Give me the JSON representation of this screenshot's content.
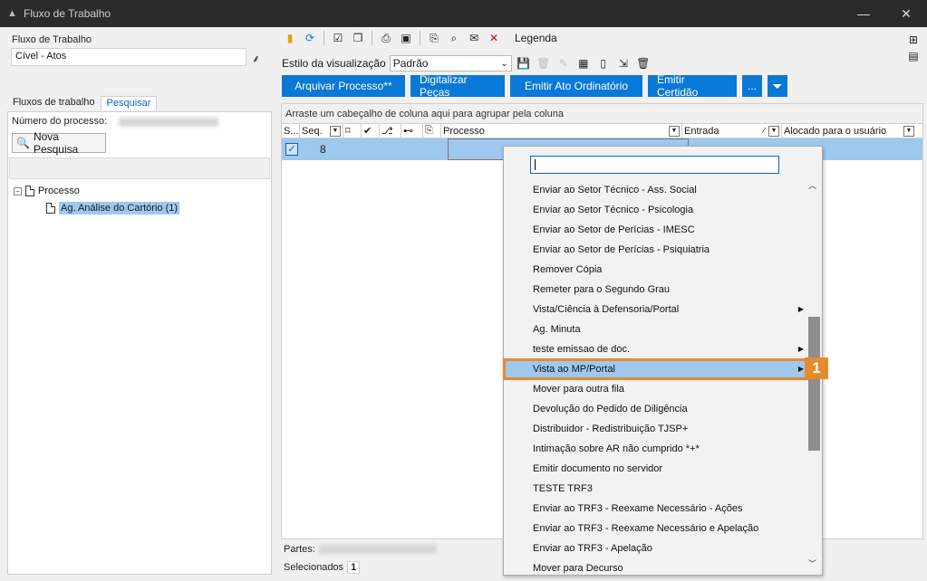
{
  "window": {
    "title": "Fluxo de Trabalho"
  },
  "left": {
    "workflow_label": "Fluxo de Trabalho",
    "workflow_value": "Cível - Atos",
    "tabs": [
      {
        "label": "Fluxos de trabalho"
      },
      {
        "label": "Pesquisar"
      }
    ],
    "process_number_label": "Número do processo:",
    "new_search_label": "Nova Pesquisa",
    "tree": {
      "root": "Processo",
      "child": "Ag. Análise do Cartório (1)"
    }
  },
  "toolbar": {
    "legend_label": "Legenda",
    "view_style_label": "Estilo da visualização",
    "view_style_value": "Padrão"
  },
  "actions": {
    "archive": "Arquivar Processo**",
    "digitize": "Digitalizar Peças",
    "ordinatory": "Emitir Ato Ordinatório",
    "certificate": "Emitir Certidão",
    "more": "..."
  },
  "grid": {
    "group_hint": "Arraste um cabeçalho de coluna aqui para agrupar pela coluna",
    "columns": {
      "s": "S...",
      "seq": "Seq.",
      "processo": "Processo",
      "entrada": "Entrada",
      "alocado": "Alocado para o usuário"
    },
    "row": {
      "seq": "8"
    }
  },
  "bottom": {
    "partes_label": "Partes:",
    "selecionados_label": "Selecionados",
    "selecionados_count": "1"
  },
  "menu": {
    "items": [
      {
        "label": "Enviar ao Setor Técnico - Ass. Social",
        "submenu": false
      },
      {
        "label": "Enviar ao Setor Técnico - Psicologia",
        "submenu": false
      },
      {
        "label": "Enviar ao Setor de Perícias - IMESC",
        "submenu": false
      },
      {
        "label": "Enviar ao Setor de Perícias - Psiquiatria",
        "submenu": false
      },
      {
        "label": "Remover Cópia",
        "submenu": false
      },
      {
        "label": "Remeter para o Segundo Grau",
        "submenu": false
      },
      {
        "label": "Vista/Ciência à Defensoria/Portal",
        "submenu": true
      },
      {
        "label": "Ag. Minuta",
        "submenu": false
      },
      {
        "label": "teste emissao de doc.",
        "submenu": true
      },
      {
        "label": "Vista ao MP/Portal",
        "submenu": true,
        "highlighted": true
      },
      {
        "label": "Mover para outra fila",
        "submenu": false
      },
      {
        "label": "Devolução do Pedido de Diligência",
        "submenu": false
      },
      {
        "label": "Distribuidor - Redistribuição TJSP+",
        "submenu": false
      },
      {
        "label": "Intimação sobre AR não cumprido *+*",
        "submenu": false
      },
      {
        "label": "Emitir documento no servidor",
        "submenu": false
      },
      {
        "label": "TESTE TRF3",
        "submenu": false
      },
      {
        "label": "Enviar ao TRF3 - Reexame Necessário - Ações",
        "submenu": false
      },
      {
        "label": "Enviar ao TRF3 -  Reexame Necessário e Apelação",
        "submenu": false
      },
      {
        "label": "Enviar ao TRF3 - Apelação",
        "submenu": false
      },
      {
        "label": "Mover para Decurso",
        "submenu": false
      }
    ],
    "callout": "1"
  },
  "colors": {
    "accent": "#0a78d7",
    "selection": "#9ec8ee",
    "highlight_border": "#e68a2e",
    "titlebar": "#2b2b2b"
  }
}
